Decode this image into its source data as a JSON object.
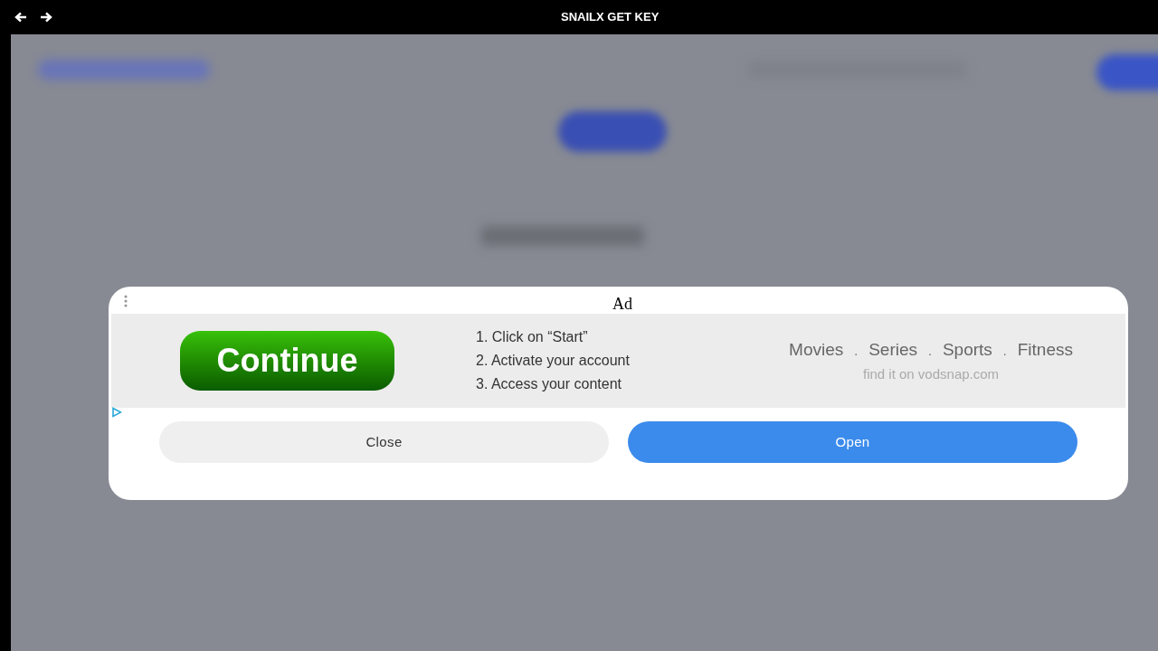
{
  "window": {
    "title": "SNAILX GET KEY"
  },
  "ad": {
    "label": "Ad",
    "cta": "Continue",
    "steps": [
      "1. Click on “Start”",
      "2. Activate your account",
      "3. Access your content"
    ],
    "categories": [
      "Movies",
      "Series",
      "Sports",
      "Fitness"
    ],
    "separators": [
      ".",
      ".",
      "."
    ],
    "tagline": "find it on vodsnap.com",
    "buttons": [
      {
        "label": "Close",
        "kind": "secondary"
      },
      {
        "label": "Open",
        "kind": "primary"
      }
    ]
  }
}
